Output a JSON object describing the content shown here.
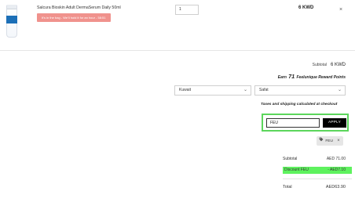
{
  "product": {
    "name": "Salcura Bioskin Adult DermaSerum Daily 50ml",
    "alert": "It's in the bag - We'll hold it for an hour - 58:51",
    "quantity": "1",
    "price": "6 KWD",
    "remove_icon": "close-icon"
  },
  "summary": {
    "subtotal_label": "Subtotal",
    "subtotal_value": "6 KWD",
    "earn_prefix": "Earn",
    "earn_points": "71",
    "earn_suffix": "Feelunique Reward Points"
  },
  "shipping": {
    "country": "Kuwait",
    "city": "Safat",
    "note": "Taxes and shipping calculated at checkout"
  },
  "coupon": {
    "input_value": "FEU",
    "apply_label": "APPLY",
    "applied_code": "FEU",
    "applied_icon": "tag-icon"
  },
  "totals": {
    "subtotal_label": "Subtotal",
    "subtotal_value": "AED 71.00",
    "discount_label": "Discount FEU",
    "discount_value": "- AED7.10",
    "total_label": "Total",
    "total_value": "AED63.90"
  },
  "colors": {
    "highlight_green": "#5ef25e",
    "box_green": "#5cd65c",
    "alert_bg": "#f0928d",
    "apply_bg": "#000000"
  }
}
